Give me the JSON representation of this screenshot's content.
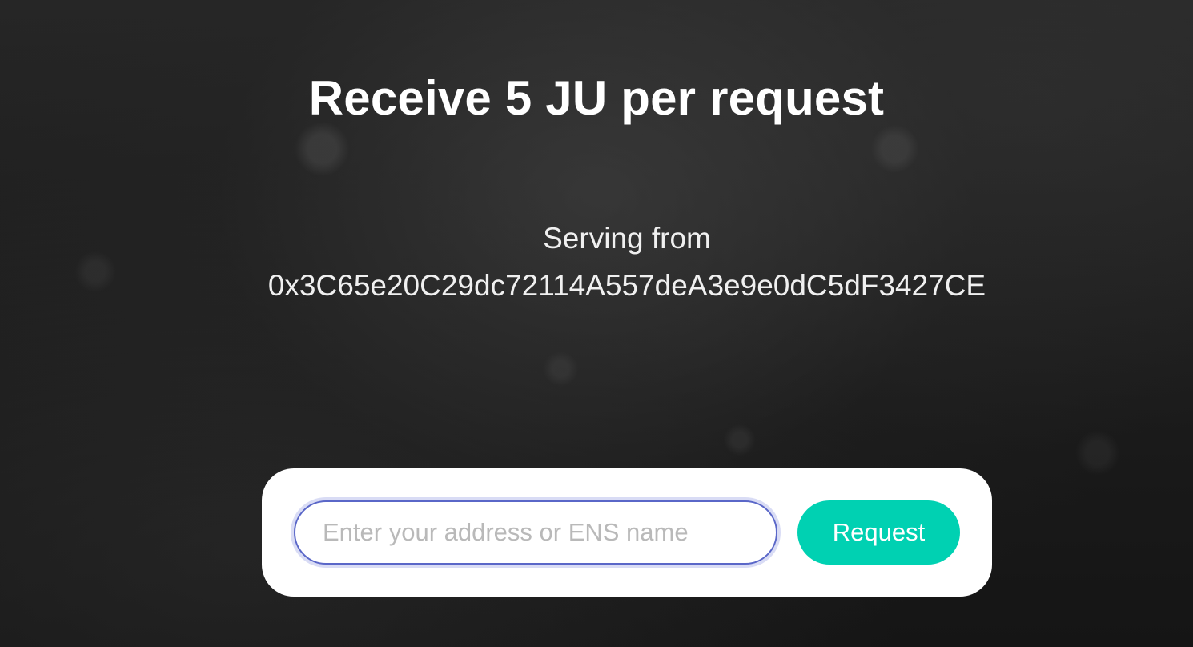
{
  "header": {
    "title": "Receive 5 JU per request"
  },
  "serving": {
    "label": "Serving from",
    "address": "0x3C65e20C29dc72114A557deA3e9e0dC5dF3427CE"
  },
  "request_form": {
    "input_value": "",
    "input_placeholder": "Enter your address or ENS name",
    "button_label": "Request"
  },
  "colors": {
    "accent": "#00d1b2",
    "input_focus_border": "#5a67c8",
    "background": "#1c1c1c"
  }
}
